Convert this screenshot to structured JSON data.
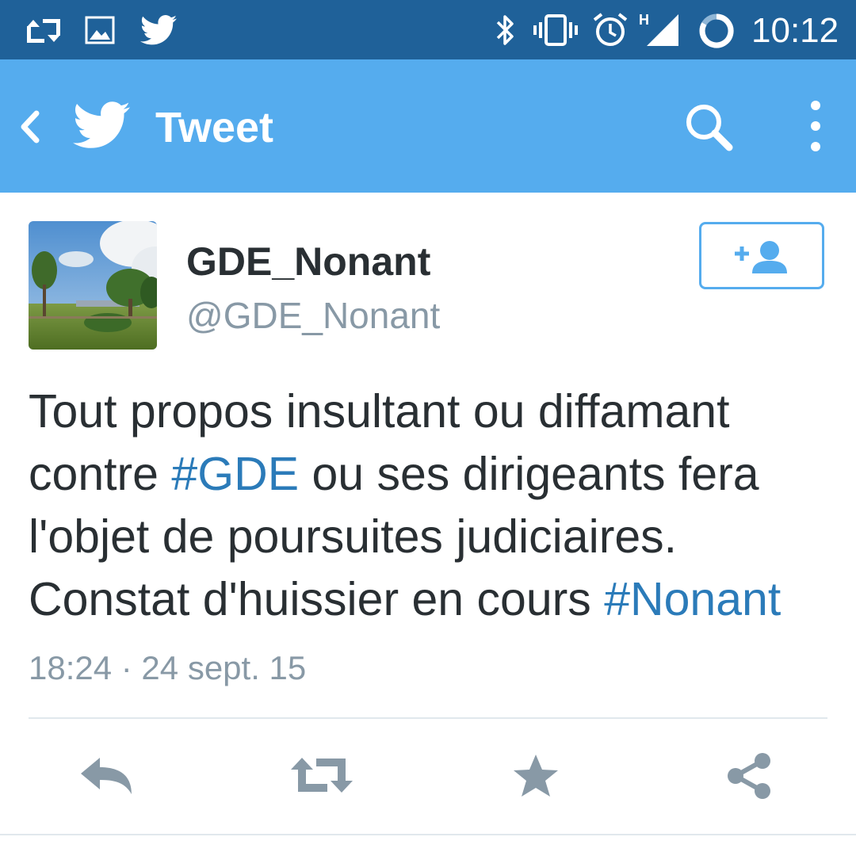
{
  "status_bar": {
    "time": "10:12",
    "icons": [
      "retweet-notification-icon",
      "image-notification-icon",
      "twitter-notification-icon",
      "bluetooth-icon",
      "vibrate-icon",
      "alarm-icon",
      "signal-h-icon",
      "battery-icon"
    ],
    "network_type": "H",
    "background_color": "#1f6199"
  },
  "action_bar": {
    "title": "Tweet",
    "background_color": "#55acee",
    "icons": [
      "back-icon",
      "twitter-logo-icon",
      "search-icon",
      "more-options-icon"
    ]
  },
  "tweet": {
    "author": {
      "display_name": "GDE_Nonant",
      "screen_name": "@GDE_Nonant"
    },
    "follow_icon": "add-user-icon",
    "text_lines": [
      {
        "before": "Tout propos insultant ou diffamant",
        "hashtag": "",
        "after": ""
      },
      {
        "before": "contre ",
        "hashtag": "#GDE",
        "after": " ou ses dirigeants fera"
      },
      {
        "before": "l'objet de poursuites judiciaires.",
        "hashtag": "",
        "after": ""
      },
      {
        "before": "Constat d'huissier en cours ",
        "hashtag": "#Nonant",
        "after": ""
      }
    ],
    "timestamp": "18:24 · 24 sept. 15",
    "hashtag_color": "#2b7bb9"
  },
  "actions": [
    "reply-icon",
    "retweet-icon",
    "favorite-star-icon",
    "share-icon"
  ]
}
